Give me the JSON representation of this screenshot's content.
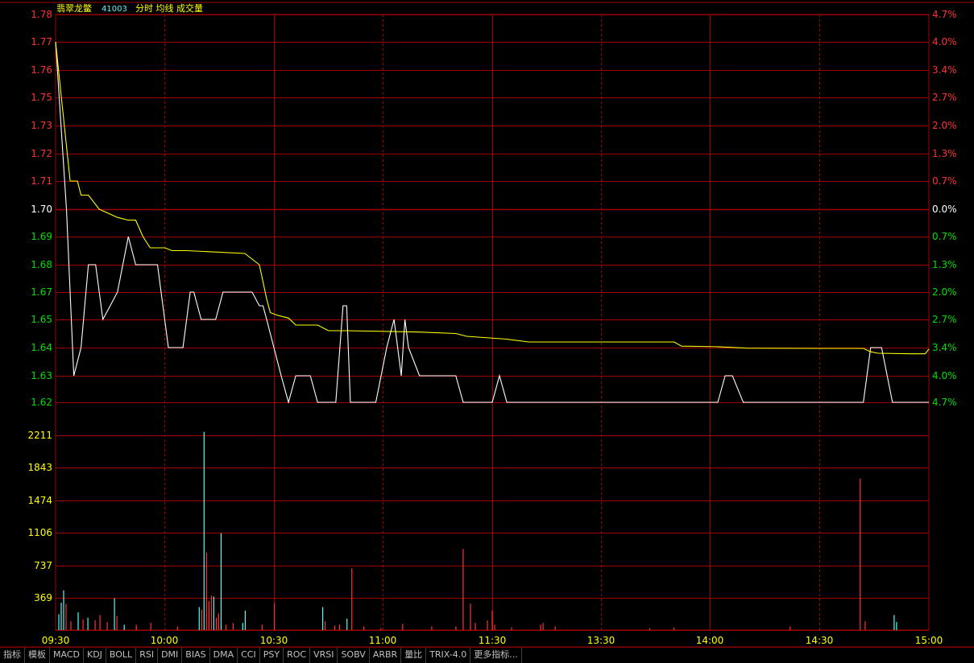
{
  "header": {
    "stock_name": "翡翠龙鳖",
    "stock_code": "41003",
    "mode_labels": [
      "分时",
      "均线",
      "成交量"
    ]
  },
  "price_axis_left": [
    "1.78",
    "1.77",
    "1.76",
    "1.75",
    "1.73",
    "1.72",
    "1.71",
    "1.70",
    "1.69",
    "1.68",
    "1.67",
    "1.65",
    "1.64",
    "1.63",
    "1.62"
  ],
  "price_axis_right": [
    "4.7%",
    "4.0%",
    "3.4%",
    "2.7%",
    "2.0%",
    "1.3%",
    "0.7%",
    "0.0%",
    "0.7%",
    "1.3%",
    "2.0%",
    "2.7%",
    "3.4%",
    "4.0%",
    "4.7%"
  ],
  "volume_axis": [
    "2211",
    "1843",
    "1474",
    "1106",
    "737",
    "369"
  ],
  "time_axis": [
    "09:30",
    "10:00",
    "10:30",
    "11:00",
    "11:30",
    "13:30",
    "14:00",
    "14:30",
    "15:00"
  ],
  "colors": {
    "background": "#000000",
    "grid": "#a00000",
    "price_line": "#ffffff",
    "avg_line": "#ffff00",
    "up": "#ff3232",
    "down": "#54fcfc",
    "axis_up_text": "#ff3232",
    "axis_down_text": "#00e000",
    "axis_flat_text": "#ffffff",
    "volume_text": "#ffff00"
  },
  "toolbar": [
    "指标",
    "模板",
    "MACD",
    "KDJ",
    "BOLL",
    "RSI",
    "DMI",
    "BIAS",
    "DMA",
    "CCI",
    "PSY",
    "ROC",
    "VRSI",
    "SOBV",
    "ARBR",
    "量比",
    "TRIX-4.0",
    "更多指标..."
  ],
  "chart_data": {
    "type": "line",
    "title": "",
    "xlabel": "",
    "ylabel": "",
    "ylim": [
      1.62,
      1.78
    ],
    "x_range_minutes": [
      0,
      240
    ],
    "series": [
      {
        "points": [
          [
            0,
            1.77
          ],
          [
            3,
            1.7
          ],
          [
            5,
            1.63
          ],
          [
            7,
            1.64
          ],
          [
            9,
            1.68
          ],
          [
            11,
            1.68
          ],
          [
            13,
            1.65
          ],
          [
            15,
            1.66
          ],
          [
            17,
            1.67
          ],
          [
            20,
            1.69
          ],
          [
            22,
            1.68
          ],
          [
            28,
            1.68
          ],
          [
            31,
            1.64
          ],
          [
            35,
            1.64
          ],
          [
            37,
            1.67
          ],
          [
            38,
            1.67
          ],
          [
            40,
            1.65
          ],
          [
            44,
            1.65
          ],
          [
            46,
            1.67
          ],
          [
            54,
            1.67
          ],
          [
            56,
            1.66
          ],
          [
            57,
            1.66
          ],
          [
            58,
            1.65
          ],
          [
            62,
            1.63
          ],
          [
            64,
            1.62
          ],
          [
            66,
            1.63
          ],
          [
            70,
            1.63
          ],
          [
            72,
            1.62
          ],
          [
            77,
            1.62
          ],
          [
            79,
            1.66
          ],
          [
            80,
            1.66
          ],
          [
            81,
            1.62
          ],
          [
            88,
            1.62
          ],
          [
            91,
            1.64
          ],
          [
            93,
            1.65
          ],
          [
            95,
            1.63
          ],
          [
            96,
            1.65
          ],
          [
            97,
            1.64
          ],
          [
            100,
            1.63
          ],
          [
            110,
            1.63
          ],
          [
            112,
            1.62
          ],
          [
            120,
            1.62
          ],
          [
            122,
            1.63
          ],
          [
            124,
            1.62
          ],
          [
            182,
            1.62
          ],
          [
            184,
            1.63
          ],
          [
            186,
            1.63
          ],
          [
            189,
            1.62
          ],
          [
            222,
            1.62
          ],
          [
            224,
            1.64
          ],
          [
            227,
            1.64
          ],
          [
            230,
            1.62
          ],
          [
            240,
            1.62
          ]
        ]
      },
      {
        "points": [
          [
            0,
            1.77
          ],
          [
            2,
            1.74
          ],
          [
            4,
            1.71
          ],
          [
            6,
            1.71
          ],
          [
            7,
            1.705
          ],
          [
            9,
            1.705
          ],
          [
            12,
            1.7
          ],
          [
            17,
            1.697
          ],
          [
            20,
            1.696
          ],
          [
            22,
            1.696
          ],
          [
            24,
            1.69
          ],
          [
            26,
            1.686
          ],
          [
            30,
            1.686
          ],
          [
            32,
            1.685
          ],
          [
            36,
            1.685
          ],
          [
            52,
            1.684
          ],
          [
            54,
            1.682
          ],
          [
            56,
            1.68
          ],
          [
            58,
            1.665
          ],
          [
            59,
            1.655
          ],
          [
            61,
            1.653
          ],
          [
            64,
            1.651
          ],
          [
            66,
            1.648
          ],
          [
            70,
            1.648
          ],
          [
            72,
            1.648
          ],
          [
            75,
            1.646
          ],
          [
            80,
            1.646
          ],
          [
            100,
            1.6455
          ],
          [
            110,
            1.645
          ],
          [
            113,
            1.644
          ],
          [
            124,
            1.643
          ],
          [
            130,
            1.642
          ],
          [
            170,
            1.642
          ],
          [
            172,
            1.6405
          ],
          [
            182,
            1.6403
          ],
          [
            190,
            1.6398
          ],
          [
            210,
            1.6397
          ],
          [
            222,
            1.6397
          ],
          [
            224,
            1.6385
          ],
          [
            226,
            1.638
          ],
          [
            235,
            1.6378
          ],
          [
            239,
            1.6378
          ],
          [
            240,
            1.6395
          ]
        ]
      }
    ],
    "volume": {
      "ylim": [
        0,
        2450
      ],
      "bars": [
        [
          1,
          180,
          "d"
        ],
        [
          2,
          310,
          "d"
        ],
        [
          3,
          450,
          "d"
        ],
        [
          4,
          300,
          "u"
        ],
        [
          6,
          100,
          "u"
        ],
        [
          9,
          200,
          "d"
        ],
        [
          11,
          120,
          "u"
        ],
        [
          13,
          140,
          "d"
        ],
        [
          16,
          110,
          "u"
        ],
        [
          18,
          170,
          "u"
        ],
        [
          21,
          90,
          "u"
        ],
        [
          24,
          360,
          "d"
        ],
        [
          25,
          160,
          "u"
        ],
        [
          28,
          60,
          "d"
        ],
        [
          33,
          60,
          "u"
        ],
        [
          39,
          80,
          "u"
        ],
        [
          50,
          40,
          "u"
        ],
        [
          59,
          260,
          "d"
        ],
        [
          60,
          230,
          "u"
        ],
        [
          61,
          2250,
          "d"
        ],
        [
          62,
          880,
          "u"
        ],
        [
          63,
          330,
          "u"
        ],
        [
          64,
          390,
          "u"
        ],
        [
          65,
          380,
          "d"
        ],
        [
          66,
          140,
          "u"
        ],
        [
          67,
          190,
          "u"
        ],
        [
          68,
          1100,
          "d"
        ],
        [
          70,
          60,
          "u"
        ],
        [
          73,
          80,
          "u"
        ],
        [
          77,
          80,
          "d"
        ],
        [
          78,
          220,
          "d"
        ],
        [
          85,
          60,
          "u"
        ],
        [
          90,
          300,
          "u"
        ],
        [
          110,
          260,
          "d"
        ],
        [
          111,
          100,
          "u"
        ],
        [
          115,
          50,
          "u"
        ],
        [
          117,
          60,
          "u"
        ],
        [
          120,
          130,
          "d"
        ],
        [
          122,
          700,
          "u"
        ],
        [
          127,
          40,
          "u"
        ],
        [
          134,
          20,
          "u"
        ],
        [
          143,
          70,
          "u"
        ],
        [
          155,
          40,
          "u"
        ],
        [
          165,
          40,
          "u"
        ],
        [
          168,
          920,
          "u"
        ],
        [
          171,
          300,
          "u"
        ],
        [
          173,
          80,
          "u"
        ],
        [
          178,
          110,
          "u"
        ],
        [
          180,
          220,
          "u"
        ],
        [
          181,
          60,
          "u"
        ],
        [
          188,
          30,
          "u"
        ],
        [
          200,
          60,
          "u"
        ],
        [
          201,
          80,
          "u"
        ],
        [
          206,
          40,
          "u"
        ],
        [
          245,
          20,
          "u"
        ],
        [
          255,
          30,
          "u"
        ],
        [
          303,
          40,
          "u"
        ],
        [
          332,
          1720,
          "u"
        ],
        [
          334,
          100,
          "u"
        ],
        [
          346,
          170,
          "d"
        ],
        [
          347,
          90,
          "d"
        ]
      ]
    }
  }
}
